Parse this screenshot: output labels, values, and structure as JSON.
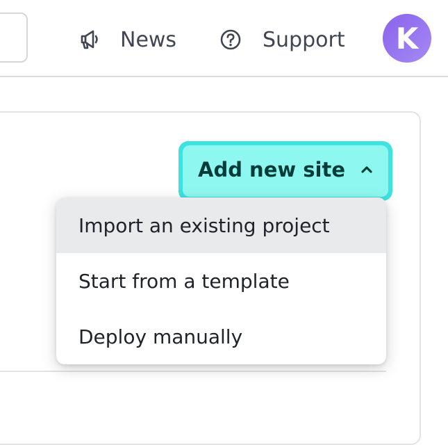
{
  "header": {
    "news_label": "News",
    "support_label": "Support",
    "avatar_initial": "K",
    "news_icon": "megaphone-icon",
    "support_icon": "question-circle-icon"
  },
  "main": {
    "add_button": {
      "label": "Add new site",
      "icon": "chevron-up-icon",
      "border_color": "#3ee2e0",
      "fill_color": "#8ef8f0"
    },
    "dropdown": {
      "items": [
        {
          "label": "Import an existing project",
          "highlighted": true
        },
        {
          "label": "Start from a template",
          "highlighted": false
        },
        {
          "label": "Deploy manually",
          "highlighted": false
        }
      ]
    }
  },
  "colors": {
    "avatar": "#8a63ea",
    "menu_highlight": "#e9eaec"
  }
}
